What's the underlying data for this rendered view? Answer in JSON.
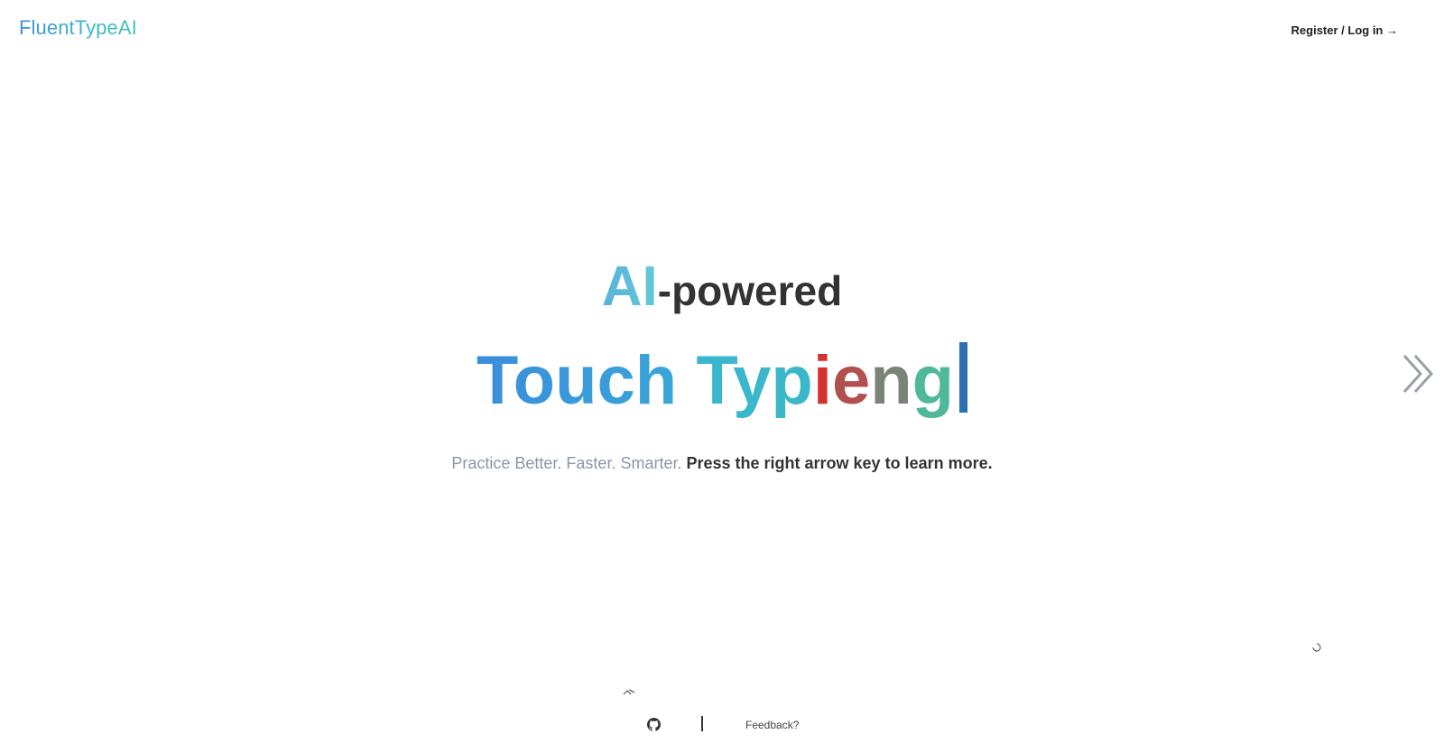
{
  "header": {
    "logo": "FluentTypeAI",
    "auth_link": "Register / Log in →"
  },
  "hero": {
    "headline_ai": "AI",
    "headline_rest": "-powered",
    "typing": {
      "word1": "Touch",
      "word2_prefix": "Typ",
      "chars": [
        "i",
        "e",
        "n",
        "g"
      ]
    },
    "tagline_muted": "Practice Better. Faster. Smarter.",
    "tagline_strong": "Press the right arrow key to learn more."
  },
  "footer": {
    "feedback": "Feedback?"
  },
  "icons": {
    "next": "double-chevron-right-icon",
    "github": "github-icon",
    "spinner": "loading-spinner-icon"
  },
  "colors": {
    "accent_blue": "#3a8ddb",
    "accent_teal": "#3ab6cf",
    "typo_red": "#d5312f",
    "cursor": "#2d6fb5"
  }
}
